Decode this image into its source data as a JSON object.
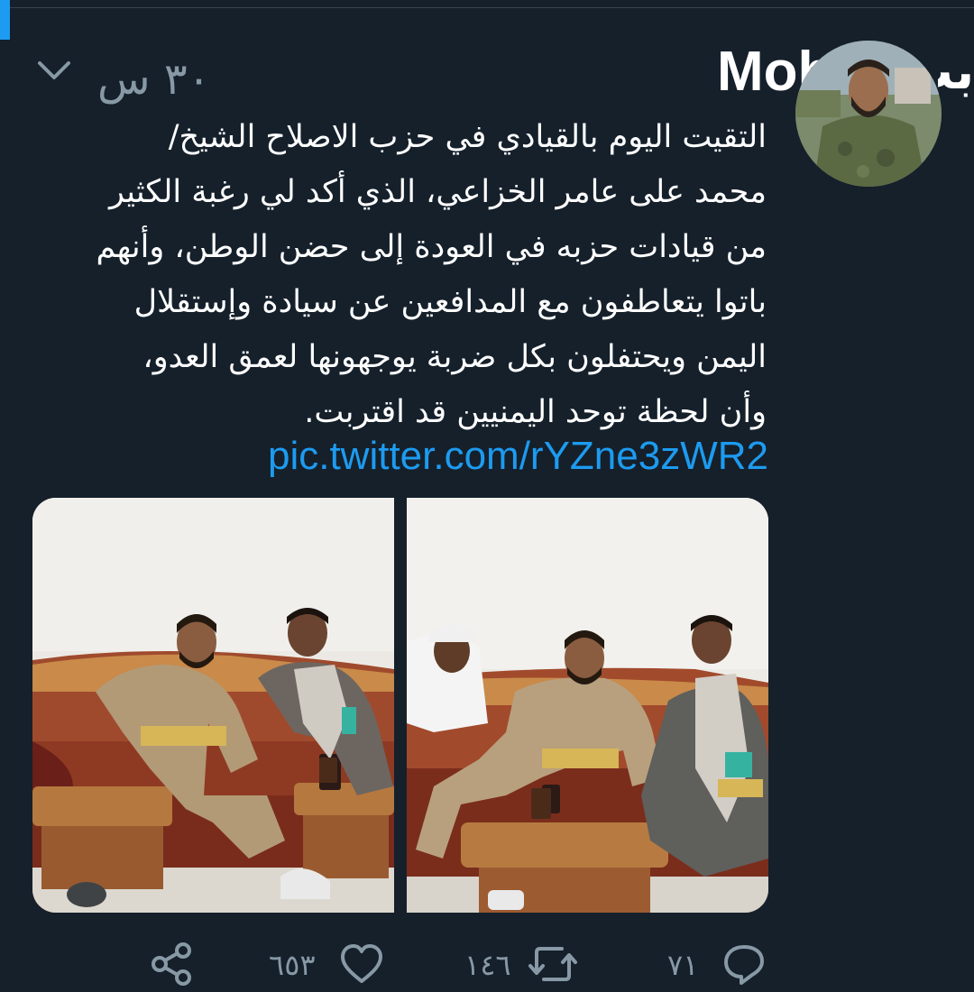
{
  "header": {
    "name": "Moh",
    "name_end": "بت",
    "timestamp": "٣٠ س"
  },
  "tweet": {
    "lines": [
      "التقيت اليوم بالقيادي في حزب الاصلاح الشيخ/",
      "محمد على عامر الخزاعي، الذي أكد لي رغبة الكثير",
      "من قيادات حزبه في العودة إلى حضن الوطن، وأنهم",
      "باتوا يتعاطفون مع المدافعين عن سيادة وإستقلال",
      "اليمن ويحتفلون بكل ضربة يوجهونها لعمق العدو،",
      "وأن لحظة توحد اليمنيين قد اقتربت."
    ],
    "link": "pic.twitter.com/rYZne3zWR2"
  },
  "actions": {
    "reply_count": "٧١",
    "retweet_count": "١٤٦",
    "like_count": "٦٥٣"
  },
  "icons": {
    "caret": "chevron-down-icon",
    "reply": "reply-icon",
    "retweet": "retweet-icon",
    "like": "heart-icon",
    "share": "share-icon"
  },
  "colors": {
    "background": "#15202b",
    "text": "#ffffff",
    "secondary": "#8899a6",
    "link": "#1d9bf0"
  }
}
